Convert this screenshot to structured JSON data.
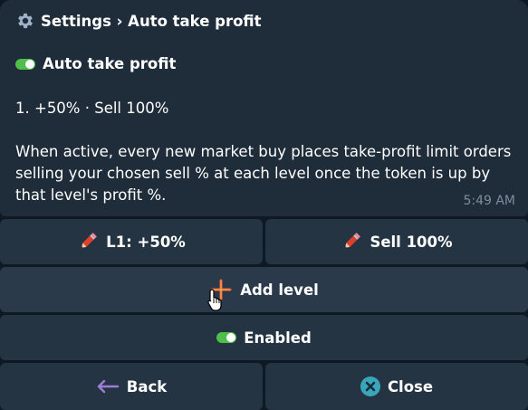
{
  "message": {
    "title": "Settings › Auto take profit",
    "status_label": "Auto take profit",
    "level_line": "1. +50% · Sell 100%",
    "description": "When active, every new market buy places take-profit limit orders selling your chosen sell % at each level once the token is up by that level's profit %.",
    "time": "5:49 AM"
  },
  "buttons": {
    "level_profit": "L1: +50%",
    "level_sell": "Sell 100%",
    "add_level": "Add level",
    "enabled": "Enabled",
    "back": "Back",
    "close": "Close"
  },
  "colors": {
    "background": "#0f1923",
    "bubble": "#1f2c3a",
    "button": "#253443",
    "toggle_on": "#4fbf4a",
    "close_icon": "#3aa6b9",
    "back_arrow": "#9b7fd6",
    "timestamp": "#7d8d9d"
  },
  "icons": {
    "title": "gear-icon",
    "status": "toggle-on-icon",
    "edit": "pencil-icon",
    "add": "plus-icon",
    "back": "left-arrow-icon",
    "close": "close-icon"
  }
}
